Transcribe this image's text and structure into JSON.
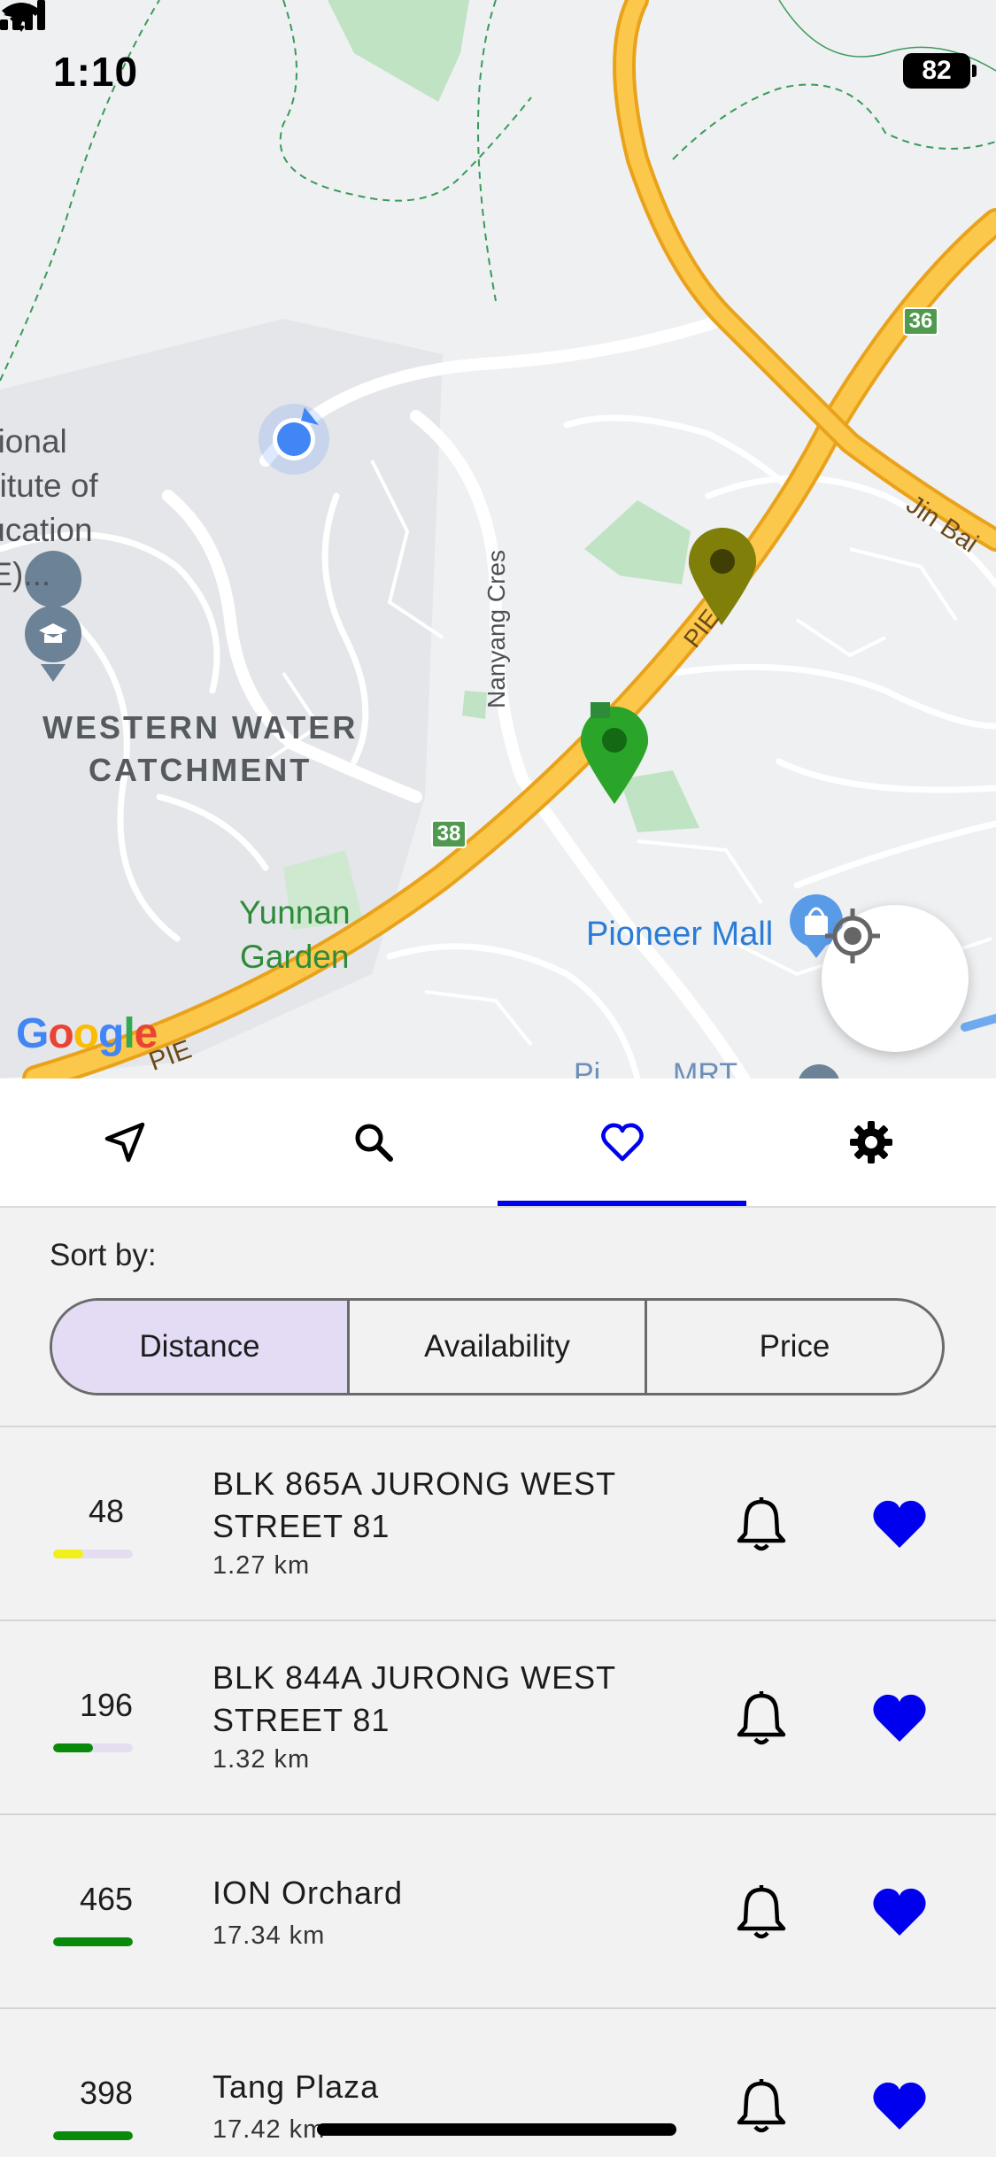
{
  "status_bar": {
    "time": "1:10",
    "battery": "82"
  },
  "map": {
    "labels": {
      "nie": "National\nInstitute of\nEducation\n(NIE)...",
      "catchment": "WESTERN WATER\nCATCHMENT",
      "yunnan": "Yunnan\nGarden",
      "pioneer": "Pioneer Mall",
      "nanyang": "Nanyang Cres",
      "jin_bai": "Jin Bai",
      "pie_1": "PIE",
      "pie_2": "PIE",
      "google": "Google"
    },
    "shields": {
      "exit_36": "36",
      "exit_38": "38"
    },
    "colors": {
      "highway": "#f7b731",
      "park": "#bfe3c3",
      "user_dot": "#4285f4",
      "pin_green": "#2aa52a",
      "pin_olive": "#7f7f0a"
    }
  },
  "tabs": [
    {
      "id": "navigate",
      "icon": "navigation-arrow-icon"
    },
    {
      "id": "search",
      "icon": "search-icon"
    },
    {
      "id": "favorites",
      "icon": "heart-outline-icon",
      "active": true
    },
    {
      "id": "settings",
      "icon": "gear-icon"
    }
  ],
  "sort": {
    "label": "Sort by:",
    "options": [
      "Distance",
      "Availability",
      "Price"
    ],
    "selected": "Distance"
  },
  "carparks": [
    {
      "lots": "48",
      "name": "BLK 865A JURONG WEST STREET 81",
      "distance": "1.27 km",
      "availability": 0.38,
      "bar_color": "#f2ef1d"
    },
    {
      "lots": "196",
      "name": "BLK 844A JURONG WEST STREET 81",
      "distance": "1.32 km",
      "availability": 0.5,
      "bar_color": "#0a8a0a"
    },
    {
      "lots": "465",
      "name": "ION Orchard",
      "distance": "17.34 km",
      "availability": 1.0,
      "bar_color": "#0a8a0a"
    },
    {
      "lots": "398",
      "name": "Tang Plaza",
      "distance": "17.42 km",
      "availability": 1.0,
      "bar_color": "#0a8a0a"
    }
  ],
  "colors": {
    "accent": "#0000ee",
    "sort_selected_bg": "#e3dcf4",
    "favorite": "#0000ee"
  }
}
